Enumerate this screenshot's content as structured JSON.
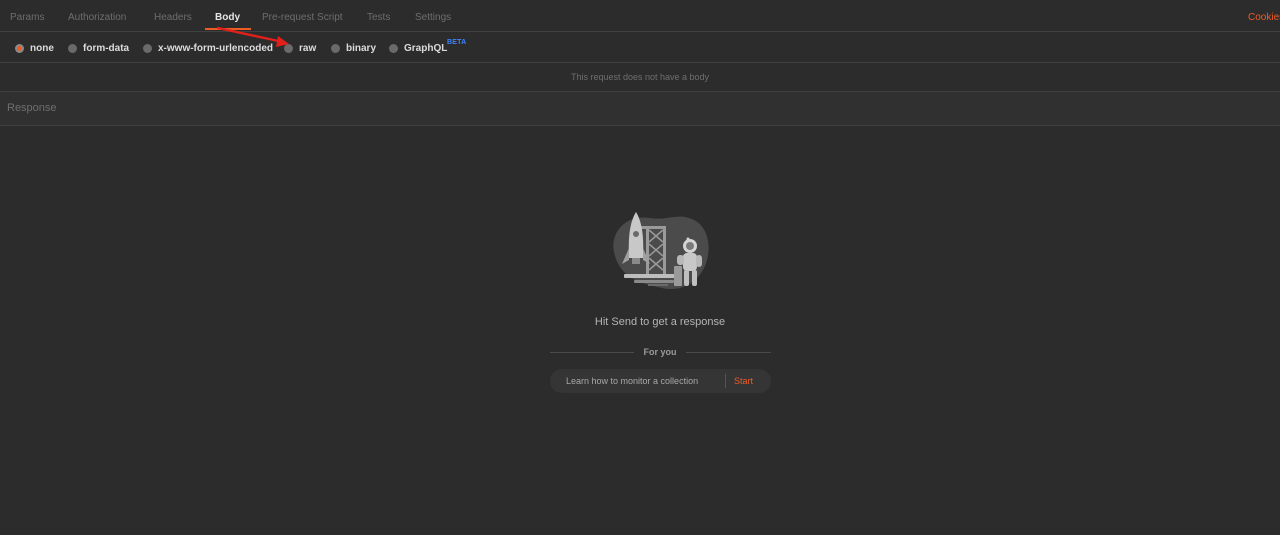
{
  "tabs": [
    {
      "label": "Params",
      "active": false
    },
    {
      "label": "Authorization",
      "active": false
    },
    {
      "label": "Headers",
      "active": false
    },
    {
      "label": "Body",
      "active": true
    },
    {
      "label": "Pre-request Script",
      "active": false
    },
    {
      "label": "Tests",
      "active": false
    },
    {
      "label": "Settings",
      "active": false
    }
  ],
  "cookies_label": "Cookies",
  "body_types": {
    "selected": "none",
    "options": [
      {
        "label": "none"
      },
      {
        "label": "form-data"
      },
      {
        "label": "x-www-form-urlencoded"
      },
      {
        "label": "raw"
      },
      {
        "label": "binary"
      },
      {
        "label": "GraphQL"
      }
    ],
    "graphql_badge": "BETA"
  },
  "no_body_message": "This request does not have a body",
  "response": {
    "title": "Response",
    "empty_message": "Hit Send to get a response",
    "for_you_label": "For you",
    "suggestion": {
      "text": "Learn how to monitor a collection",
      "action": "Start"
    }
  },
  "colors": {
    "accent": "#ef5b25",
    "background": "#2c2c2c",
    "beta": "#3a86ff",
    "annotation_arrow": "#e0201a"
  },
  "icons": {
    "illustration": "rocket-launch-astronaut-illustration"
  }
}
